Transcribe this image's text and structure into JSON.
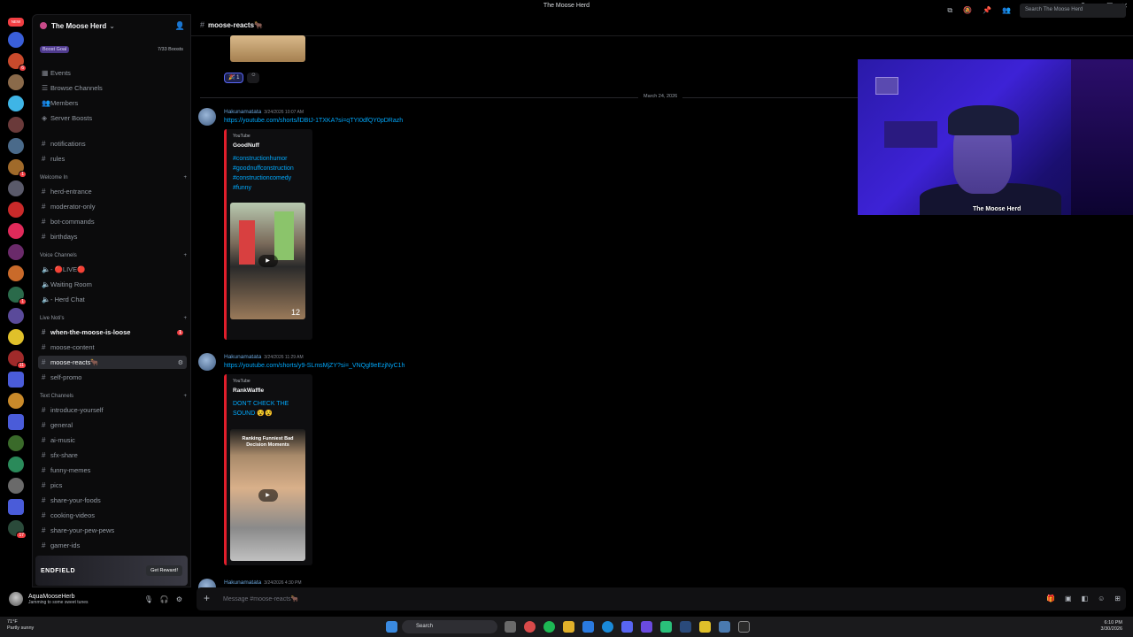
{
  "window": {
    "title": "The Moose Herd"
  },
  "guild": {
    "name": "The Moose Herd",
    "boost_goal": "Boost Goal",
    "boost_count": "7/33 Boosts"
  },
  "sidebar_top": [
    "Events",
    "Browse Channels",
    "Members",
    "Server Boosts"
  ],
  "uncategorized": [
    "notifications",
    "rules"
  ],
  "categories": {
    "welcome": "Welcome In",
    "voice": "Voice Channels",
    "live": "Live Noti's",
    "text": "Text Channels"
  },
  "welcome_channels": [
    "herd-entrance",
    "moderator-only",
    "bot-commands",
    "birthdays"
  ],
  "voice_channels": [
    "- 🔴LIVE🔴",
    "Waiting Room",
    "- Herd Chat"
  ],
  "live_channels": [
    "when-the-moose-is-loose",
    "moose-content",
    "moose-reacts🐂",
    "self-promo"
  ],
  "live_unread_count": "1",
  "text_channels": [
    "introduce-yourself",
    "general",
    "ai-music",
    "sfx-share",
    "funny-memes",
    "pics",
    "share-your-foods",
    "cooking-videos",
    "share-your-pew-pews",
    "gamer-ids"
  ],
  "server_badges": [
    "6",
    "1",
    "1",
    "1",
    "11",
    "17"
  ],
  "promo": {
    "logo": "ENDFIELD",
    "button": "Get Reward!"
  },
  "user": {
    "name": "AquaMooseHerb",
    "status": "Jamming to some sweet tunes"
  },
  "channel": {
    "name": "moose-reacts🐂"
  },
  "search": {
    "placeholder": "Search The Moose Herd"
  },
  "reaction": {
    "count": "1"
  },
  "date_separator": "March 24, 2026",
  "messages": [
    {
      "author": "Hakunamatata",
      "time": "3/24/2026 10:07 AM",
      "link": "https://youtube.com/shorts/lDBtJ-1TXKA?si=qTYI0dfQY0pDRazh",
      "provider": "YouTube",
      "embed_author": "GoodNuff",
      "embed_title": "#constructionhumor #goodnuffconstruction #constructioncomedy #funny",
      "overlay": "12"
    },
    {
      "author": "Hakunamatata",
      "time": "3/24/2026 11:29 AM",
      "link": "https://youtube.com/shorts/y9-SLmsMjZY?si=_VNQgl9eEzjNyC1h",
      "provider": "YouTube",
      "embed_author": "RankWaffle",
      "embed_title": "DON'T CHECK THE SOUND 😵😵",
      "overlay": "Ranking Funniest Bad Decision Moments"
    },
    {
      "author": "Hakunamatata",
      "time": "3/24/2026 4:30 PM"
    }
  ],
  "composer": {
    "placeholder": "Message #moose-reacts🐂"
  },
  "webcam": {
    "label": "The Moose Herd"
  },
  "taskbar": {
    "weather_temp": "71°F",
    "weather_desc": "Partly sunny",
    "search": "Search",
    "time": "6:10 PM",
    "date": "3/30/2026"
  },
  "colors": {
    "accent": "#5865f2",
    "link": "#00a8fc",
    "embed_bar": "#e01e2b",
    "unread": "#f23f43"
  }
}
